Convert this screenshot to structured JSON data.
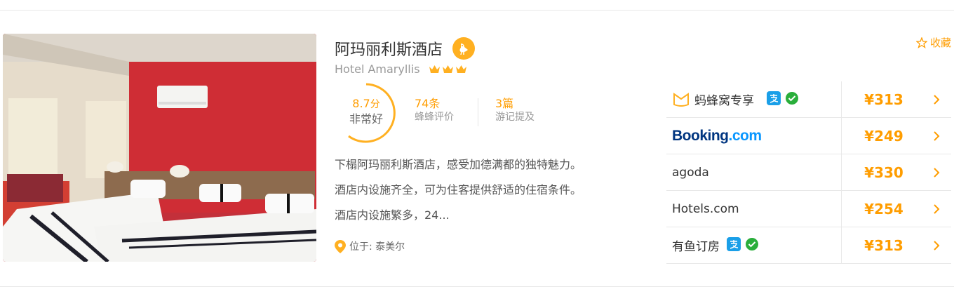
{
  "hotel": {
    "name_cn": "阿玛丽利斯酒店",
    "name_en": "Hotel Amaryllis",
    "score": "8.7",
    "score_unit": "分",
    "score_label": "非常好",
    "reviews_count": "74条",
    "reviews_label": "蜂蜂评价",
    "travelogues_count": "3篇",
    "travelogues_label": "游记提及",
    "description": [
      "下榻阿玛丽利斯酒店，感受加德满都的独特魅力。",
      "酒店内设施齐全，可为住客提供舒适的住宿条件。",
      "酒店内设施繁多，24..."
    ],
    "location": "位于: 泰美尔",
    "favorite_label": "收藏",
    "star_rating": 3
  },
  "prices": [
    {
      "vendor": "蚂蜂窝专享",
      "price": "¥313",
      "icons": [
        "alipay-icon",
        "wechat-pay-icon"
      ]
    },
    {
      "vendor_logo_text": "Booking.com",
      "price": "¥249"
    },
    {
      "vendor": "agoda",
      "price": "¥330"
    },
    {
      "vendor": "Hotels.com",
      "price": "¥254"
    },
    {
      "vendor": "有鱼订房",
      "price": "¥313",
      "icons": [
        "alipay-icon",
        "wechat-pay-icon"
      ]
    }
  ],
  "colors": {
    "accent": "#ff9d00",
    "badge": "#ffb021",
    "booking_blue": "#003580",
    "booking_light": "#0896ff",
    "alipay": "#1a9fe8",
    "wechat": "#2aae3b"
  }
}
